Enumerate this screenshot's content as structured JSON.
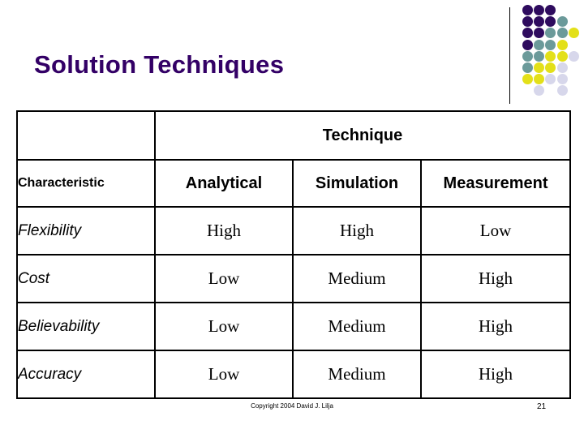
{
  "slide": {
    "title": "Solution Techniques",
    "title_color": "#330066"
  },
  "decor": {
    "dot_grid_name": "dot-grid-decoration",
    "colors": {
      "purple": "#2E0B5E",
      "teal": "#6B9A9A",
      "yellow": "#E3E019",
      "lavender": "#D7D7EB"
    },
    "dots": [
      {
        "col": 0,
        "row": 0,
        "color": "#2E0B5E"
      },
      {
        "col": 1,
        "row": 0,
        "color": "#2E0B5E"
      },
      {
        "col": 2,
        "row": 0,
        "color": "#2E0B5E"
      },
      {
        "col": 0,
        "row": 1,
        "color": "#2E0B5E"
      },
      {
        "col": 1,
        "row": 1,
        "color": "#2E0B5E"
      },
      {
        "col": 2,
        "row": 1,
        "color": "#2E0B5E"
      },
      {
        "col": 3,
        "row": 1,
        "color": "#6B9A9A"
      },
      {
        "col": 0,
        "row": 2,
        "color": "#2E0B5E"
      },
      {
        "col": 1,
        "row": 2,
        "color": "#2E0B5E"
      },
      {
        "col": 2,
        "row": 2,
        "color": "#6B9A9A"
      },
      {
        "col": 3,
        "row": 2,
        "color": "#6B9A9A"
      },
      {
        "col": 4,
        "row": 2,
        "color": "#E3E019"
      },
      {
        "col": 0,
        "row": 3,
        "color": "#2E0B5E"
      },
      {
        "col": 1,
        "row": 3,
        "color": "#6B9A9A"
      },
      {
        "col": 2,
        "row": 3,
        "color": "#6B9A9A"
      },
      {
        "col": 3,
        "row": 3,
        "color": "#E3E019"
      },
      {
        "col": 0,
        "row": 4,
        "color": "#6B9A9A"
      },
      {
        "col": 1,
        "row": 4,
        "color": "#6B9A9A"
      },
      {
        "col": 2,
        "row": 4,
        "color": "#E3E019"
      },
      {
        "col": 3,
        "row": 4,
        "color": "#E3E019"
      },
      {
        "col": 4,
        "row": 4,
        "color": "#D7D7EB"
      },
      {
        "col": 0,
        "row": 5,
        "color": "#6B9A9A"
      },
      {
        "col": 1,
        "row": 5,
        "color": "#E3E019"
      },
      {
        "col": 2,
        "row": 5,
        "color": "#E3E019"
      },
      {
        "col": 3,
        "row": 5,
        "color": "#D7D7EB"
      },
      {
        "col": 0,
        "row": 6,
        "color": "#E3E019"
      },
      {
        "col": 1,
        "row": 6,
        "color": "#E3E019"
      },
      {
        "col": 2,
        "row": 6,
        "color": "#D7D7EB"
      },
      {
        "col": 3,
        "row": 6,
        "color": "#D7D7EB"
      },
      {
        "col": 1,
        "row": 7,
        "color": "#D7D7EB"
      },
      {
        "col": 3,
        "row": 7,
        "color": "#D7D7EB"
      }
    ]
  },
  "table": {
    "group_header": "Technique",
    "corner_header": "Characteristic",
    "columns": [
      "Analytical",
      "Simulation",
      "Measurement"
    ],
    "rows": [
      {
        "label": "Flexibility",
        "values": [
          "High",
          "High",
          "Low"
        ]
      },
      {
        "label": "Cost",
        "values": [
          "Low",
          "Medium",
          "High"
        ]
      },
      {
        "label": "Believability",
        "values": [
          "Low",
          "Medium",
          "High"
        ]
      },
      {
        "label": "Accuracy",
        "values": [
          "Low",
          "Medium",
          "High"
        ]
      }
    ]
  },
  "footer": {
    "copyright": "Copyright 2004 David J. Lilja",
    "page_number": "21"
  }
}
